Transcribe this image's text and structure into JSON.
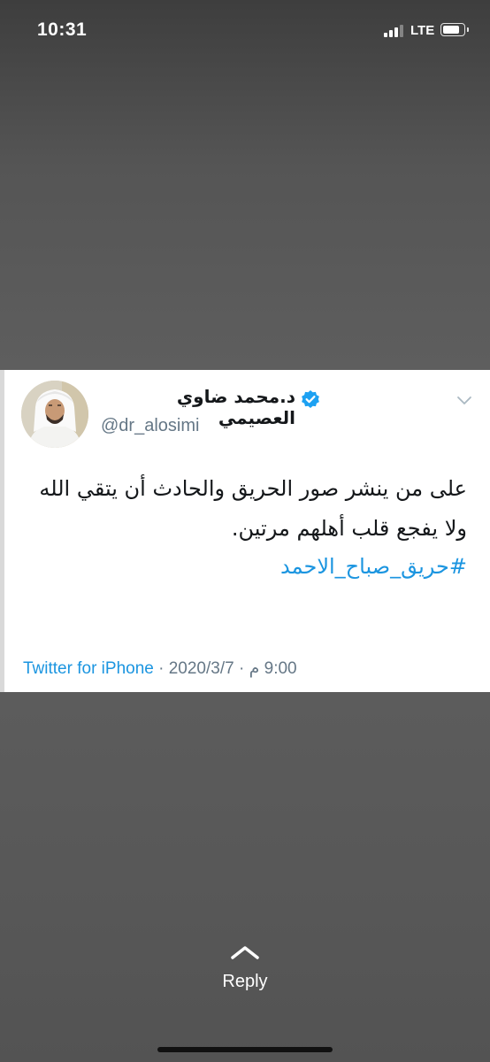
{
  "status_bar": {
    "time": "10:31",
    "network": "LTE",
    "signal_bars": 3,
    "signal_bars_total": 4,
    "battery_level": 0.9
  },
  "tweet": {
    "display_name": "د.محمد ضاوي العصيمي",
    "handle": "@dr_alosimi",
    "verified": true,
    "text": "على من ينشر صور الحريق والحادث أن يتقي الله ولا يفجع قلب أهلهم مرتين.",
    "hashtag": "#حريق_صباح_الاحمد",
    "source": "Twitter for iPhone",
    "date": "2020/3/7",
    "time": "9:00 م",
    "separator": " · "
  },
  "colors": {
    "link": "#1b95e0",
    "verified": "#1da1f2",
    "muted": "#657786",
    "text": "#14171a",
    "backdrop": "#555555"
  },
  "icons": {
    "verified": "verified-badge-icon",
    "chevron": "chevron-down-icon",
    "reply": "chevron-up-icon"
  },
  "reply": {
    "label": "Reply"
  }
}
